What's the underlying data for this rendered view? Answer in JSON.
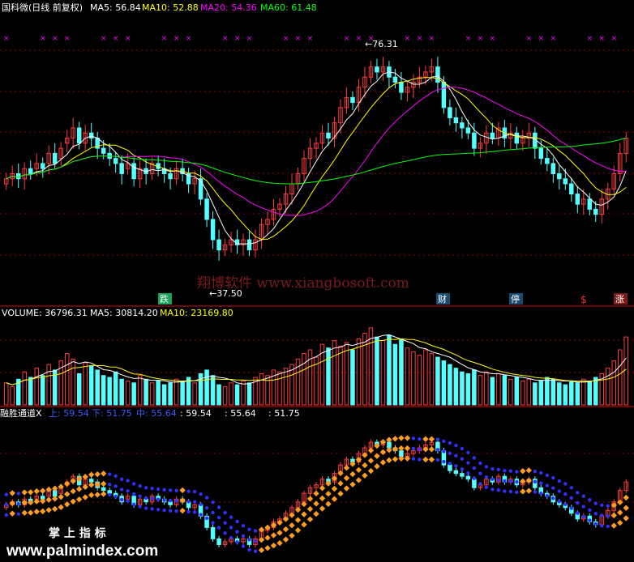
{
  "colors": {
    "background": "#000000",
    "up": "#ff3c3c",
    "down": "#54ffff",
    "ma5": "#ffffff",
    "ma10": "#ffff00",
    "ma20": "#ff00ff",
    "ma60": "#00ff00",
    "divider": "#b00000",
    "grid": "#8a0000",
    "channel_blue": "#3030ff",
    "channel_orange": "#ff9e1e",
    "label_text": "#ffffff",
    "watermark": "#7a1a1a",
    "markers": "#ff00ff"
  },
  "panel1": {
    "title": "国科微(日线 前复权)",
    "ma5": "MA5: 56.84",
    "ma10": "MA10: 52.88",
    "ma20": "MA20: 54.36",
    "ma60": "MA60: 61.48",
    "high_label": "←76.31",
    "low_label": "←37.50",
    "watermark": "翔博软件 www.xiangbosoft.com",
    "tags": [
      {
        "text": "跌",
        "bg": "#1aa35a",
        "color": "#ffffff"
      },
      {
        "text": "财",
        "bg": "#1a4b6e",
        "color": "#ffffff"
      },
      {
        "text": "停",
        "bg": "#1a4b6e",
        "color": "#ffffff"
      },
      {
        "text": "$",
        "bg": "#000000",
        "color": "#ff3030"
      },
      {
        "text": "涨",
        "bg": "#7a1a1a",
        "color": "#ffffff"
      }
    ]
  },
  "panel2": {
    "title": "VOLUME: 36796.31",
    "ma5": "MA5: 30814.20",
    "ma10": "MA10: 23169.80"
  },
  "panel3": {
    "title": "融胜通道X",
    "up": "上: 59.54",
    "down": "下: 51.75",
    "mid": "中: 55.64",
    "v1": ": 59.54",
    "v2": ": 55.64",
    "v3": ": 51.75",
    "watermark1": "掌 上 指 标",
    "watermark2": "www.palmindex.com"
  },
  "chart_data": [
    {
      "type": "candlestick",
      "title": "国科微(日线 前复权)",
      "annotations": [
        "←76.31",
        "←37.50"
      ],
      "ylim": [
        33,
        80
      ],
      "series": [
        {
          "name": "MA5",
          "values": []
        },
        {
          "name": "MA10",
          "values": []
        },
        {
          "name": "MA20",
          "values": []
        },
        {
          "name": "MA60",
          "values": []
        }
      ],
      "close": [
        52,
        53,
        52,
        54,
        53,
        55,
        54,
        57,
        55,
        58,
        60,
        62,
        59,
        61,
        60,
        58,
        57,
        56,
        55,
        53,
        55,
        52,
        54,
        53,
        55,
        54,
        53,
        52,
        54,
        53,
        51,
        52,
        48,
        44,
        40,
        38,
        39,
        40,
        39,
        40,
        38,
        40,
        43,
        44,
        46,
        47,
        49,
        51,
        53,
        56,
        58,
        59,
        61,
        60,
        63,
        66,
        68,
        67,
        70,
        72,
        74,
        73,
        74,
        72,
        71,
        69,
        70,
        71,
        72,
        73,
        74,
        71,
        66,
        64,
        63,
        62,
        61,
        58,
        59,
        61,
        60,
        62,
        60,
        61,
        59,
        60,
        61,
        58,
        56,
        55,
        53,
        52,
        51,
        49,
        47,
        48,
        46,
        45,
        48,
        50,
        53,
        57,
        60
      ],
      "open": [
        51,
        52,
        53,
        52,
        54,
        54,
        55,
        55,
        57,
        56,
        59,
        60,
        62,
        59,
        61,
        60,
        58,
        57,
        56,
        55,
        54,
        55,
        52,
        54,
        53,
        55,
        54,
        53,
        52,
        54,
        53,
        51,
        52,
        48,
        44,
        40,
        38,
        39,
        40,
        39,
        40,
        38,
        40,
        43,
        44,
        46,
        47,
        49,
        51,
        53,
        56,
        58,
        59,
        61,
        60,
        63,
        66,
        68,
        67,
        70,
        72,
        74,
        73,
        74,
        72,
        71,
        69,
        70,
        71,
        72,
        73,
        74,
        71,
        66,
        64,
        63,
        62,
        61,
        58,
        59,
        61,
        60,
        62,
        60,
        61,
        59,
        60,
        61,
        58,
        56,
        55,
        53,
        52,
        51,
        49,
        47,
        48,
        46,
        45,
        48,
        50,
        53,
        57
      ]
    },
    {
      "type": "bar",
      "title": "VOLUME: 36796.31",
      "series": [
        {
          "name": "MA5",
          "values": []
        },
        {
          "name": "MA10",
          "values": []
        }
      ],
      "values": [
        12,
        10,
        14,
        18,
        15,
        20,
        16,
        22,
        19,
        24,
        28,
        25,
        17,
        23,
        21,
        19,
        16,
        15,
        18,
        14,
        13,
        12,
        16,
        14,
        12,
        13,
        11,
        12,
        14,
        13,
        15,
        12,
        17,
        19,
        16,
        11,
        10,
        12,
        11,
        13,
        12,
        15,
        17,
        16,
        19,
        18,
        20,
        22,
        25,
        28,
        30,
        26,
        33,
        31,
        35,
        32,
        34,
        30,
        36,
        39,
        42,
        37,
        35,
        38,
        33,
        36,
        31,
        29,
        27,
        30,
        28,
        26,
        24,
        22,
        20,
        18,
        17,
        19,
        16,
        18,
        15,
        17,
        16,
        14,
        15,
        13,
        14,
        12,
        13,
        15,
        14,
        12,
        11,
        13,
        12,
        14,
        13,
        15,
        17,
        20,
        24,
        30,
        37
      ]
    },
    {
      "type": "line",
      "title": "融胜通道X",
      "series": [
        {
          "name": "上",
          "values": [
            59.54
          ]
        },
        {
          "name": "中",
          "values": [
            55.64
          ]
        },
        {
          "name": "下",
          "values": [
            51.75
          ]
        }
      ]
    }
  ]
}
